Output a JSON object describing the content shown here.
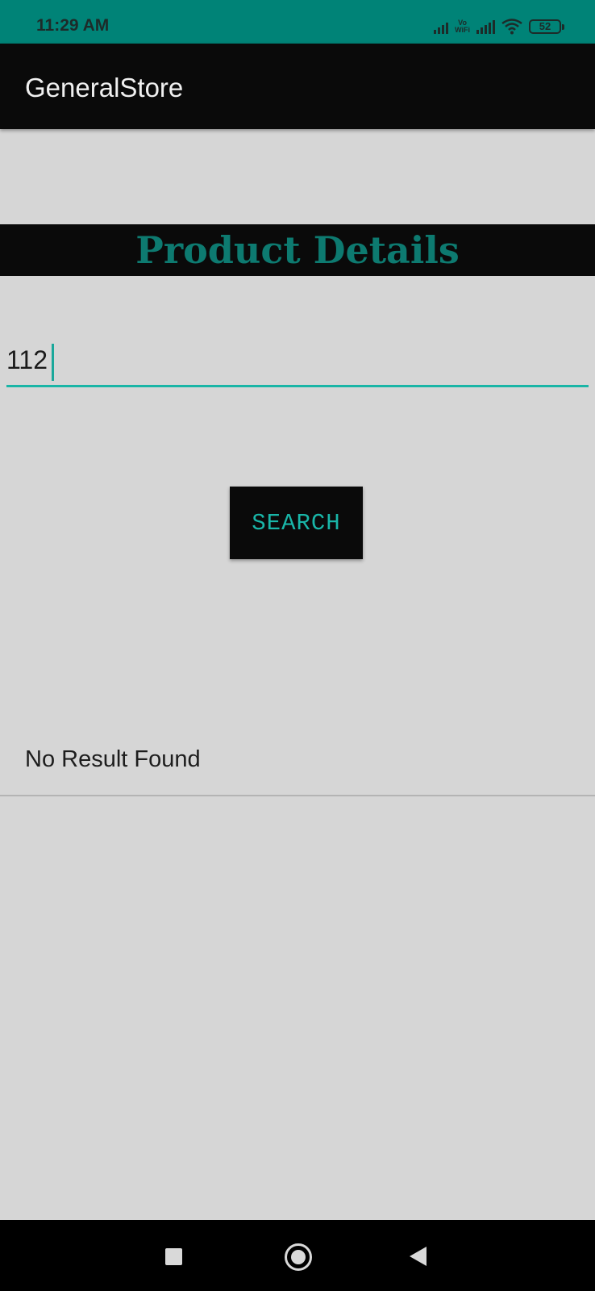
{
  "status_bar": {
    "time": "11:29 AM",
    "vowifi_top": "Vo",
    "vowifi_bottom": "WiFi",
    "battery": "52",
    "icons": [
      "signal-icon",
      "vowifi-icon",
      "signal-icon",
      "wifi-icon",
      "battery-icon"
    ]
  },
  "app_bar": {
    "title": "GeneralStore"
  },
  "main": {
    "header": "Product Details",
    "search_input_value": "112",
    "search_button_label": "SEARCH",
    "result_text": "No Result Found"
  },
  "nav_bar": {
    "icons": [
      "recent-apps-icon",
      "home-icon",
      "back-icon"
    ]
  },
  "colors": {
    "status_bar": "#008377",
    "app_bar": "#0a0a0a",
    "accent": "#1ab5a6",
    "header_text": "#0d7a70",
    "background": "#d6d6d6"
  }
}
